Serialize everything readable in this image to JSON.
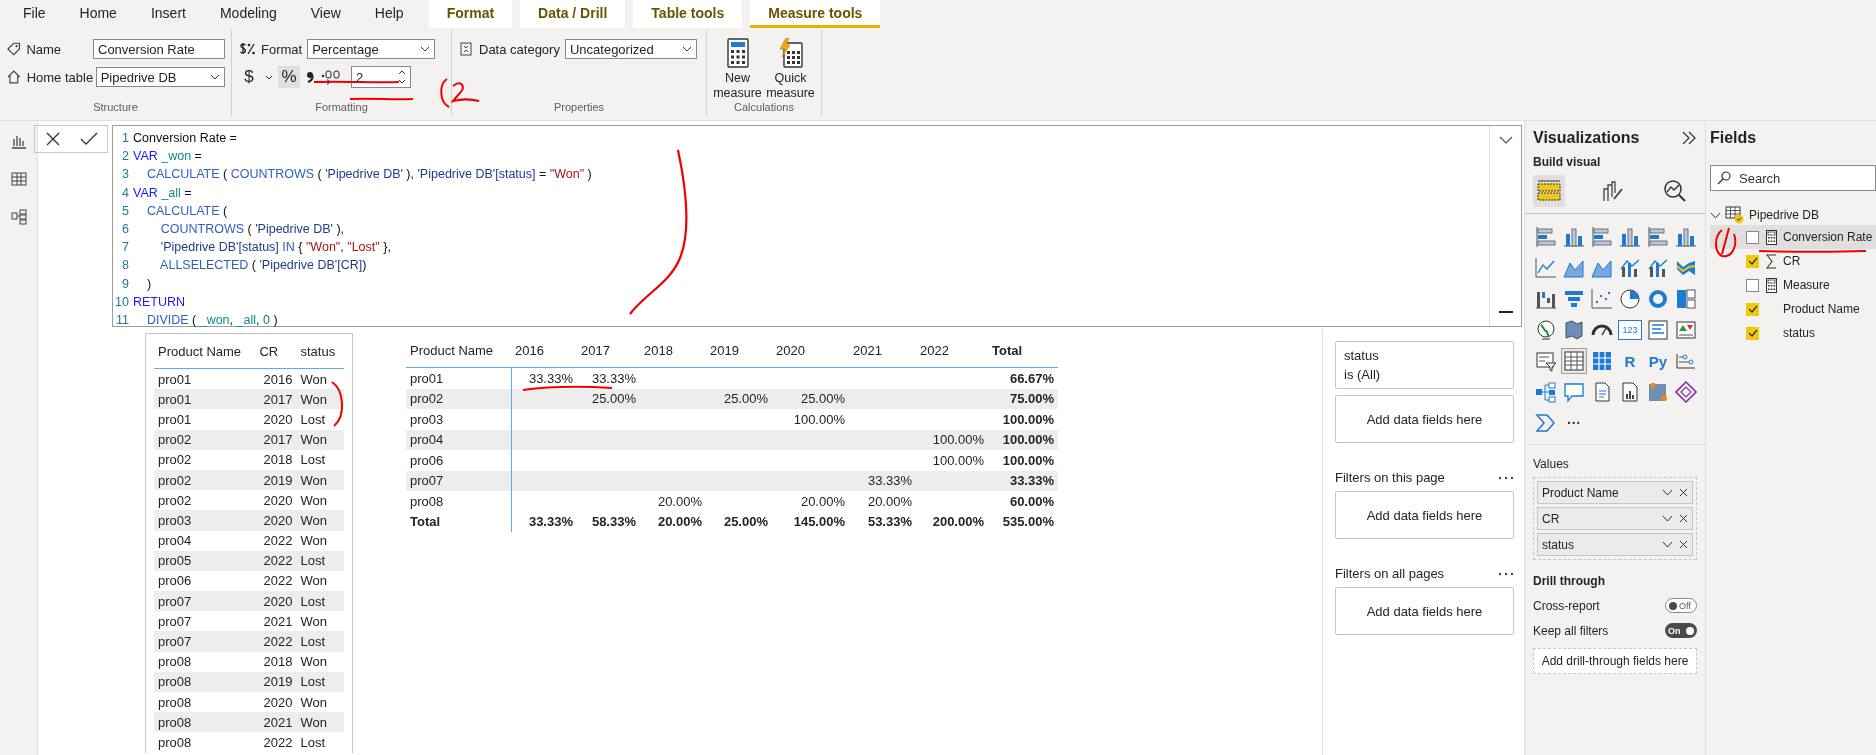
{
  "ribbon": {
    "tabs": [
      {
        "label": "File",
        "kind": "standard",
        "selected": false
      },
      {
        "label": "Home",
        "kind": "standard",
        "selected": false
      },
      {
        "label": "Insert",
        "kind": "standard",
        "selected": false
      },
      {
        "label": "Modeling",
        "kind": "standard",
        "selected": false
      },
      {
        "label": "View",
        "kind": "standard",
        "selected": false
      },
      {
        "label": "Help",
        "kind": "standard",
        "selected": false
      },
      {
        "label": "Format",
        "kind": "contextual",
        "selected": false
      },
      {
        "label": "Data / Drill",
        "kind": "contextual",
        "selected": false
      },
      {
        "label": "Table tools",
        "kind": "contextual",
        "selected": false
      },
      {
        "label": "Measure tools",
        "kind": "contextual",
        "selected": true
      }
    ],
    "structure": {
      "title": "Structure",
      "name_label": "Name",
      "name_value": "Conversion Rate",
      "home_table_label": "Home table",
      "home_table_value": "Pipedrive DB"
    },
    "formatting": {
      "title": "Formatting",
      "format_label": "Format",
      "format_value": "Percentage",
      "currency_symbol": "$",
      "percent_symbol": "%",
      "percent_selected": true,
      "decimal_places": "2"
    },
    "properties": {
      "title": "Properties",
      "data_category_label": "Data category",
      "data_category_value": "Uncategorized"
    },
    "calculations": {
      "title": "Calculations",
      "buttons": [
        {
          "label": "New measure",
          "kind": "new"
        },
        {
          "label": "Quick measure",
          "kind": "quick"
        }
      ]
    }
  },
  "formula_bar": {
    "lines": [
      {
        "number": "1",
        "tokens": [
          {
            "text": "Conversion Rate =",
            "kind": "plain"
          }
        ]
      },
      {
        "number": "2",
        "tokens": [
          {
            "text": "VAR",
            "kind": "keyword"
          },
          {
            "text": " _won",
            "kind": "variable"
          },
          {
            "text": " =",
            "kind": "plain"
          }
        ]
      },
      {
        "number": "3",
        "tokens": [
          {
            "text": "    CALCULATE",
            "kind": "function"
          },
          {
            "text": " ( ",
            "kind": "plain"
          },
          {
            "text": "COUNTROWS",
            "kind": "function"
          },
          {
            "text": " ( ",
            "kind": "plain"
          },
          {
            "text": "'Pipedrive DB'",
            "kind": "table"
          },
          {
            "text": " ), ",
            "kind": "plain"
          },
          {
            "text": "'Pipedrive DB'[status]",
            "kind": "table"
          },
          {
            "text": " = ",
            "kind": "plain"
          },
          {
            "text": "\"Won\"",
            "kind": "string"
          },
          {
            "text": " )",
            "kind": "plain"
          }
        ]
      },
      {
        "number": "4",
        "tokens": [
          {
            "text": "VAR",
            "kind": "keyword"
          },
          {
            "text": " _all",
            "kind": "variable"
          },
          {
            "text": " =",
            "kind": "plain"
          }
        ]
      },
      {
        "number": "5",
        "tokens": [
          {
            "text": "    CALCULATE",
            "kind": "function"
          },
          {
            "text": " (",
            "kind": "plain"
          }
        ]
      },
      {
        "number": "6",
        "tokens": [
          {
            "text": "        COUNTROWS",
            "kind": "function"
          },
          {
            "text": " ( ",
            "kind": "plain"
          },
          {
            "text": "'Pipedrive DB'",
            "kind": "table"
          },
          {
            "text": " ),",
            "kind": "plain"
          }
        ]
      },
      {
        "number": "7",
        "tokens": [
          {
            "text": "        'Pipedrive DB'[status]",
            "kind": "table"
          },
          {
            "text": " IN",
            "kind": "function"
          },
          {
            "text": " { ",
            "kind": "plain"
          },
          {
            "text": "\"Won\"",
            "kind": "string"
          },
          {
            "text": ", ",
            "kind": "plain"
          },
          {
            "text": "\"Lost\"",
            "kind": "string"
          },
          {
            "text": " },",
            "kind": "plain"
          }
        ]
      },
      {
        "number": "8",
        "tokens": [
          {
            "text": "        ALLSELECTED",
            "kind": "function"
          },
          {
            "text": " ( ",
            "kind": "plain"
          },
          {
            "text": "'Pipedrive DB'[CR]",
            "kind": "table"
          },
          {
            "text": ")",
            "kind": "plain"
          }
        ]
      },
      {
        "number": "9",
        "tokens": [
          {
            "text": "    )",
            "kind": "plain"
          }
        ]
      },
      {
        "number": "10",
        "tokens": [
          {
            "text": "RETURN",
            "kind": "keyword"
          }
        ]
      },
      {
        "number": "11",
        "tokens": [
          {
            "text": "    DIVIDE",
            "kind": "function"
          },
          {
            "text": " ( ",
            "kind": "plain"
          },
          {
            "text": "_won",
            "kind": "variable"
          },
          {
            "text": ", ",
            "kind": "plain"
          },
          {
            "text": "_all",
            "kind": "variable"
          },
          {
            "text": ", ",
            "kind": "plain"
          },
          {
            "text": "0",
            "kind": "number"
          },
          {
            "text": " )",
            "kind": "plain"
          }
        ]
      }
    ]
  },
  "table": {
    "columns": [
      "Product Name",
      "CR",
      "status"
    ],
    "rows": [
      [
        "pro01",
        "2016",
        "Won"
      ],
      [
        "pro01",
        "2017",
        "Won"
      ],
      [
        "pro01",
        "2020",
        "Lost"
      ],
      [
        "pro02",
        "2017",
        "Won"
      ],
      [
        "pro02",
        "2018",
        "Lost"
      ],
      [
        "pro02",
        "2019",
        "Won"
      ],
      [
        "pro02",
        "2020",
        "Won"
      ],
      [
        "pro03",
        "2020",
        "Won"
      ],
      [
        "pro04",
        "2022",
        "Won"
      ],
      [
        "pro05",
        "2022",
        "Lost"
      ],
      [
        "pro06",
        "2022",
        "Won"
      ],
      [
        "pro07",
        "2020",
        "Lost"
      ],
      [
        "pro07",
        "2021",
        "Won"
      ],
      [
        "pro07",
        "2022",
        "Lost"
      ],
      [
        "pro08",
        "2018",
        "Won"
      ],
      [
        "pro08",
        "2019",
        "Lost"
      ],
      [
        "pro08",
        "2020",
        "Won"
      ],
      [
        "pro08",
        "2021",
        "Won"
      ],
      [
        "pro08",
        "2022",
        "Lost"
      ]
    ]
  },
  "matrix": {
    "columns": [
      "Product Name",
      "2016",
      "2017",
      "2018",
      "2019",
      "2020",
      "2021",
      "2022",
      "Total"
    ],
    "rows": [
      [
        "pro01",
        "33.33%",
        "33.33%",
        null,
        null,
        null,
        null,
        null,
        "66.67%"
      ],
      [
        "pro02",
        null,
        "25.00%",
        null,
        "25.00%",
        "25.00%",
        null,
        null,
        "75.00%"
      ],
      [
        "pro03",
        null,
        null,
        null,
        null,
        "100.00%",
        null,
        null,
        "100.00%"
      ],
      [
        "pro04",
        null,
        null,
        null,
        null,
        null,
        null,
        "100.00%",
        "100.00%"
      ],
      [
        "pro06",
        null,
        null,
        null,
        null,
        null,
        null,
        "100.00%",
        "100.00%"
      ],
      [
        "pro07",
        null,
        null,
        null,
        null,
        null,
        "33.33%",
        null,
        "33.33%"
      ],
      [
        "pro08",
        null,
        null,
        "20.00%",
        null,
        "20.00%",
        "20.00%",
        null,
        "60.00%"
      ]
    ],
    "total_row": [
      "Total",
      "33.33%",
      "58.33%",
      "20.00%",
      "25.00%",
      "145.00%",
      "53.33%",
      "200.00%",
      "535.00%"
    ]
  },
  "filters": {
    "cards": [
      {
        "field": "status",
        "condition": "is (All)"
      }
    ],
    "visual_add": "Add data fields here",
    "sections": [
      {
        "title": "Filters on this page",
        "add": "Add data fields here"
      },
      {
        "title": "Filters on all pages",
        "add": "Add data fields here"
      }
    ]
  },
  "visualizations": {
    "title": "Visualizations",
    "subtitle": "Build visual",
    "build_tabs": [
      {
        "kind": "fields",
        "selected": true
      },
      {
        "kind": "format",
        "selected": false
      },
      {
        "kind": "analytics",
        "selected": false
      }
    ],
    "visual_types": [
      {
        "kind": "hbar",
        "selected": false
      },
      {
        "kind": "vbar",
        "selected": false
      },
      {
        "kind": "hbar",
        "selected": false
      },
      {
        "kind": "vbar",
        "selected": false
      },
      {
        "kind": "hbar",
        "selected": false
      },
      {
        "kind": "vbar",
        "selected": false
      },
      {
        "kind": "line",
        "selected": false
      },
      {
        "kind": "area",
        "selected": false
      },
      {
        "kind": "area",
        "selected": false
      },
      {
        "kind": "combo",
        "selected": false
      },
      {
        "kind": "combo",
        "selected": false
      },
      {
        "kind": "ribbon",
        "selected": false
      },
      {
        "kind": "waterfall",
        "selected": false
      },
      {
        "kind": "funnel",
        "selected": false
      },
      {
        "kind": "scatter",
        "selected": false
      },
      {
        "kind": "pie",
        "selected": false
      },
      {
        "kind": "donut",
        "selected": false
      },
      {
        "kind": "treemap",
        "selected": false
      },
      {
        "kind": "globe",
        "selected": false
      },
      {
        "kind": "map",
        "selected": false
      },
      {
        "kind": "gauge",
        "selected": false
      },
      {
        "kind": "card",
        "label": "123",
        "selected": false
      },
      {
        "kind": "list",
        "selected": false
      },
      {
        "kind": "kpi",
        "selected": false
      },
      {
        "kind": "slicer",
        "selected": false
      },
      {
        "kind": "table",
        "selected": true
      },
      {
        "kind": "matrix",
        "selected": false
      },
      {
        "kind": "text",
        "label": "R",
        "selected": false
      },
      {
        "kind": "text",
        "label": "Py",
        "selected": false
      },
      {
        "kind": "influencers",
        "selected": false
      },
      {
        "kind": "tree",
        "selected": false
      },
      {
        "kind": "speech",
        "selected": false
      },
      {
        "kind": "document",
        "selected": false
      },
      {
        "kind": "report",
        "selected": false
      },
      {
        "kind": "pin",
        "selected": false
      },
      {
        "kind": "diamond",
        "selected": false
      },
      {
        "kind": "chevron",
        "selected": false
      },
      {
        "kind": "more",
        "label": "···",
        "selected": false
      }
    ],
    "values_title": "Values",
    "wells": [
      "Product Name",
      "CR",
      "status"
    ],
    "drill_title": "Drill through",
    "toggles": [
      {
        "label": "Cross-report",
        "state_text": "Off",
        "on": false
      },
      {
        "label": "Keep all filters",
        "state_text": "On",
        "on": true
      }
    ],
    "drill_placeholder": "Add drill-through fields here"
  },
  "fields": {
    "title": "Fields",
    "search_placeholder": "Search",
    "tables": [
      {
        "name": "Pipedrive DB",
        "expanded": true,
        "children": [
          {
            "name": "Conversion Rate",
            "kind": "measure",
            "checked": false,
            "selected": true
          },
          {
            "name": "CR",
            "kind": "sum",
            "checked": true,
            "selected": false
          },
          {
            "name": "Measure",
            "kind": "measure",
            "checked": false,
            "selected": false
          },
          {
            "name": "Product Name",
            "kind": "column",
            "checked": true,
            "selected": false
          },
          {
            "name": "status",
            "kind": "column",
            "checked": true,
            "selected": false
          }
        ]
      }
    ]
  }
}
